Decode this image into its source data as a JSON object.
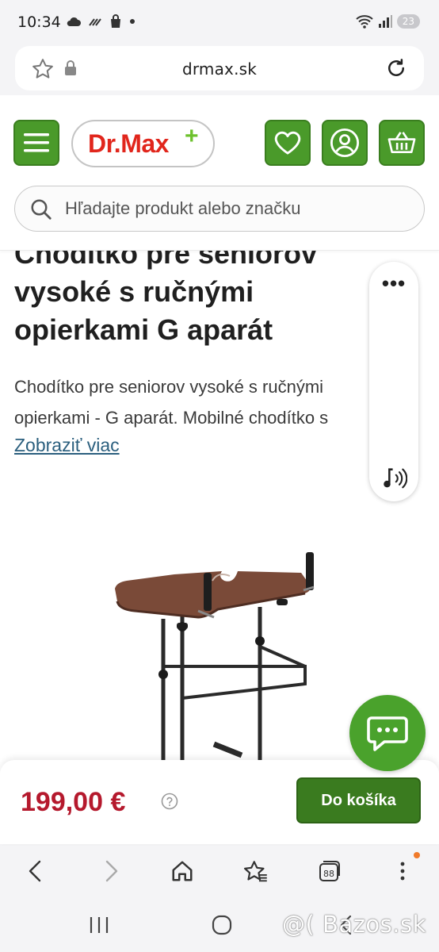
{
  "status_bar": {
    "time": "10:34",
    "battery": "23"
  },
  "browser": {
    "url": "drmax.sk"
  },
  "header": {
    "logo_text": "Dr.Max",
    "logo_plus": "+",
    "search_placeholder": "Hľadajte produkt alebo značku",
    "brand_color": "#4a9a2a",
    "logo_color": "#e1261c"
  },
  "product": {
    "title": "Chodítko pre seniorov vysoké s ručnými opierkami G aparát",
    "description_line1": "Chodítko pre seniorov vysoké s ručnými",
    "description_line2": "opierkami - G aparát. Mobilné chodítko s",
    "show_more": "Zobraziť viac",
    "price": "199,00 €",
    "price_color": "#b5192d",
    "add_to_cart": "Do košíka"
  },
  "side_panel": {
    "more_label": "•••"
  },
  "icons": {
    "header": [
      "menu-icon",
      "heart-icon",
      "user-icon",
      "basket-icon",
      "search-icon"
    ],
    "browser_bottom": [
      "back-icon",
      "forward-icon",
      "home-icon",
      "bookmark-star-icon",
      "tabs-icon",
      "more-icon"
    ],
    "system_nav": [
      "recent-apps-icon",
      "home-circle-icon",
      "back-nav-icon"
    ]
  },
  "tabs_count": "88",
  "watermark": "@( Bazos.sk"
}
